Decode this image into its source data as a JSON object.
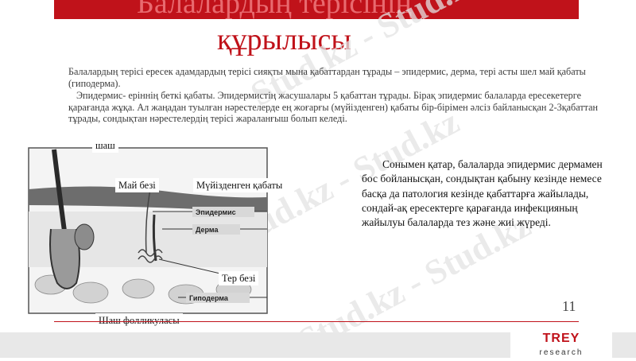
{
  "slide": {
    "title_line1": "Балалардың терісінің",
    "title_line2": "құрылысы",
    "paragraph1": "Балалардың терісі ересек адамдардың  терісі сияқты мына қабаттардан тұрады – эпидермис, дерма, тері асты шел май қабаты (гиподерма).",
    "paragraph2": "Эпидермис- еріннің беткі қабаты. Эпидермистің жасушалары 5 қабаттан тұрады. Бірақ эпидермис балаларда ересекетерге қарағанда жұқа. Ал жаңадан туылған нәрестелерде ең жоғарғы (мүйізденген) қабаты бір-бірімен әлсіз байланысқан 2-3қабаттан тұрады, сондықтан нәрестелердің терісі жараланғыш болып келеді.",
    "right_text": "Сонымен қатар, балаларда эпидермис дермамен бос бойланысқан, сондықтан қабыну кезінде немесе басқа да патология кезінде қабаттарға жайылады, сондай-ақ ересектерге қарағанда инфекцияның жайылуы балаларда тез және жиі жүреді.",
    "page_number": "11"
  },
  "diagram": {
    "labels": {
      "hair": "шаш",
      "sebaceous_gland": "Май безі",
      "stratum_corneum": "Мүйізденген қабаты",
      "sweat_gland": "Тер безі",
      "hair_follicle": "Шаш фолликуласы"
    },
    "layer_labels": {
      "epidermis": "Эпидермис",
      "dermis": "Дерма",
      "hypodermis": "Гиподерма"
    }
  },
  "watermark": "Stud.kz - Stud.kz",
  "brand": {
    "name": "TREY",
    "sub": "research"
  },
  "colors": {
    "accent": "#c0121a",
    "text": "#3a3a3a",
    "footer": "#e8e8e8"
  }
}
